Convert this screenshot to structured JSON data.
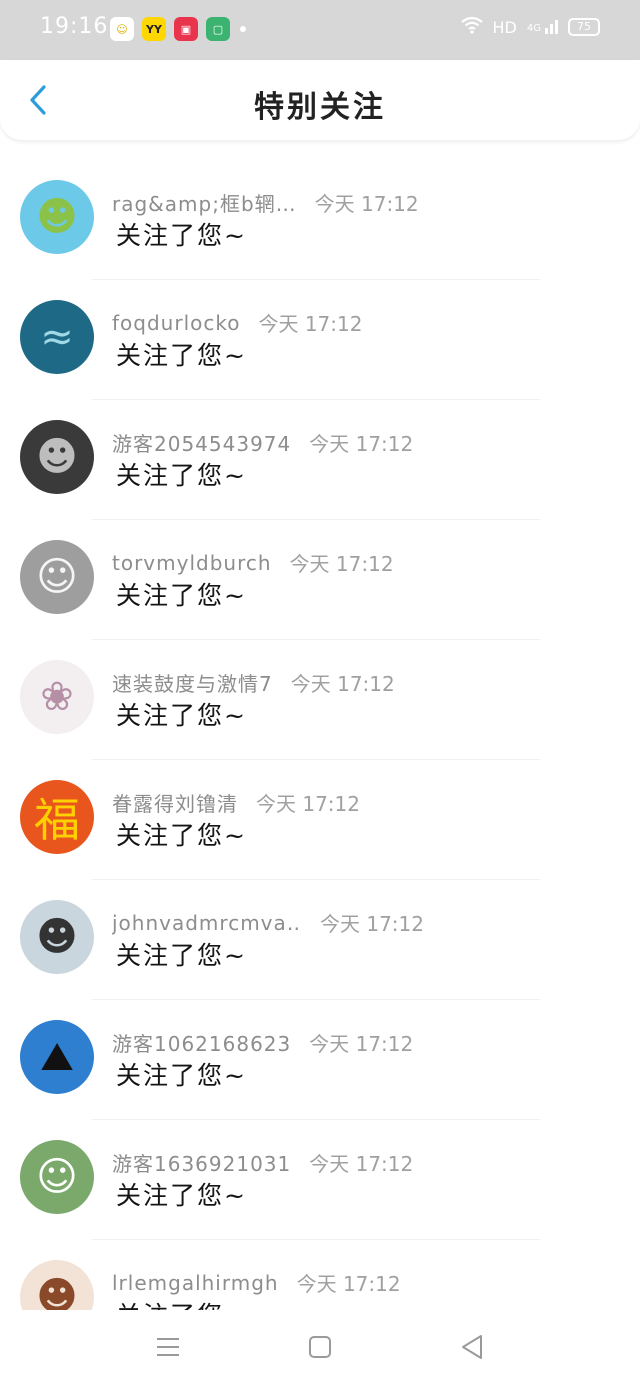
{
  "status": {
    "time": "19:16",
    "apps": [
      {
        "name": "qq-icon",
        "glyph": "☺",
        "bg": "#ffffff",
        "color": "#e0b000"
      },
      {
        "name": "yy-icon",
        "glyph": "YY",
        "bg": "#ffd700",
        "color": "#222222"
      },
      {
        "name": "video-icon",
        "glyph": "▣",
        "bg": "#e8344c",
        "color": "#ffffff"
      },
      {
        "name": "wechat-icon",
        "glyph": "▢",
        "bg": "#3cb371",
        "color": "#ffffff"
      }
    ],
    "hd": "HD",
    "network": "4G",
    "battery": "75"
  },
  "header": {
    "title": "特别关注"
  },
  "rows": [
    {
      "name": "rag&amp;框b辋…",
      "time": "今天 17:12",
      "message": "关注了您~",
      "avatar": "cartoon-avatar",
      "bg": "#6cc9e8",
      "fg": "#8bc34a",
      "glyph": "☻"
    },
    {
      "name": "foqdurlocko",
      "time": "今天 17:12",
      "message": "关注了您~",
      "avatar": "underwater-avatar",
      "bg": "#1e6a86",
      "fg": "#9fd8e6",
      "glyph": "≈"
    },
    {
      "name": "游客2054543974",
      "time": "今天 17:12",
      "message": "关注了您~",
      "avatar": "portrait-avatar",
      "bg": "#3a3a3a",
      "fg": "#bdbdbd",
      "glyph": "☻"
    },
    {
      "name": "torvmyldburch",
      "time": "今天 17:12",
      "message": "关注了您~",
      "avatar": "girl-avatar",
      "bg": "#9e9e9e",
      "fg": "#f5f5f5",
      "glyph": "☺"
    },
    {
      "name": "速装鼓度与激情7",
      "time": "今天 17:12",
      "message": "关注了您~",
      "avatar": "illustration-avatar",
      "bg": "#f3eef0",
      "fg": "#b48fa6",
      "glyph": "❀"
    },
    {
      "name": "眷露得刘镥清",
      "time": "今天 17:12",
      "message": "关注了您~",
      "avatar": "fu-avatar",
      "bg": "#e8561d",
      "fg": "#ffd000",
      "glyph": "福"
    },
    {
      "name": "johnvadmrcmva…",
      "time": "今天 17:12",
      "message": "关注了您~",
      "avatar": "boy-avatar",
      "bg": "#c9d6de",
      "fg": "#333333",
      "glyph": "☻"
    },
    {
      "name": "游客1062168623",
      "time": "今天 17:12",
      "message": "关注了您~",
      "avatar": "climber-avatar",
      "bg": "#2f7fd0",
      "fg": "#111111",
      "glyph": "⛰"
    },
    {
      "name": "游客1636921031",
      "time": "今天 17:12",
      "message": "关注了您~",
      "avatar": "photo-avatar",
      "bg": "#7aa96b",
      "fg": "#ffffff",
      "glyph": "☺"
    },
    {
      "name": "lrlemgalhirmgh",
      "time": "今天 17:12",
      "message": "关注了您~",
      "avatar": "anime-avatar",
      "bg": "#f2e3d6",
      "fg": "#8a4a2a",
      "glyph": "☻"
    }
  ]
}
